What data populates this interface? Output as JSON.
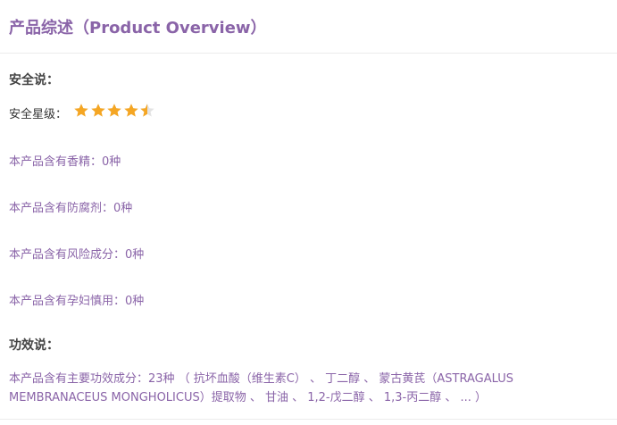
{
  "header": {
    "title": "产品综述（Product Overview）"
  },
  "safety": {
    "section_title": "安全说：",
    "rating_label": "安全星级：",
    "rating_value": 4.5,
    "rating_max": 5,
    "star_color": "#f5a623",
    "fragrance": "本产品含有香精：0种",
    "preservative": "本产品含有防腐剂：0种",
    "risk": "本产品含有风险成分：0种",
    "pregnancy": "本产品含有孕妇慎用：0种"
  },
  "efficacy": {
    "section_title": "功效说：",
    "line1": "本产品含有主要功效成分：23种 （ 抗坏血酸（维生素C） 、 丁二醇 、 蒙古黄芪（ASTRAGALUS",
    "line2": "MEMBRANACEUS MONGHOLICUS）提取物 、 甘油 、 1,2-戊二醇 、 1,3-丙二醇 、 ... ）"
  },
  "colors": {
    "accent": "#8a64a8",
    "text": "#333333"
  }
}
